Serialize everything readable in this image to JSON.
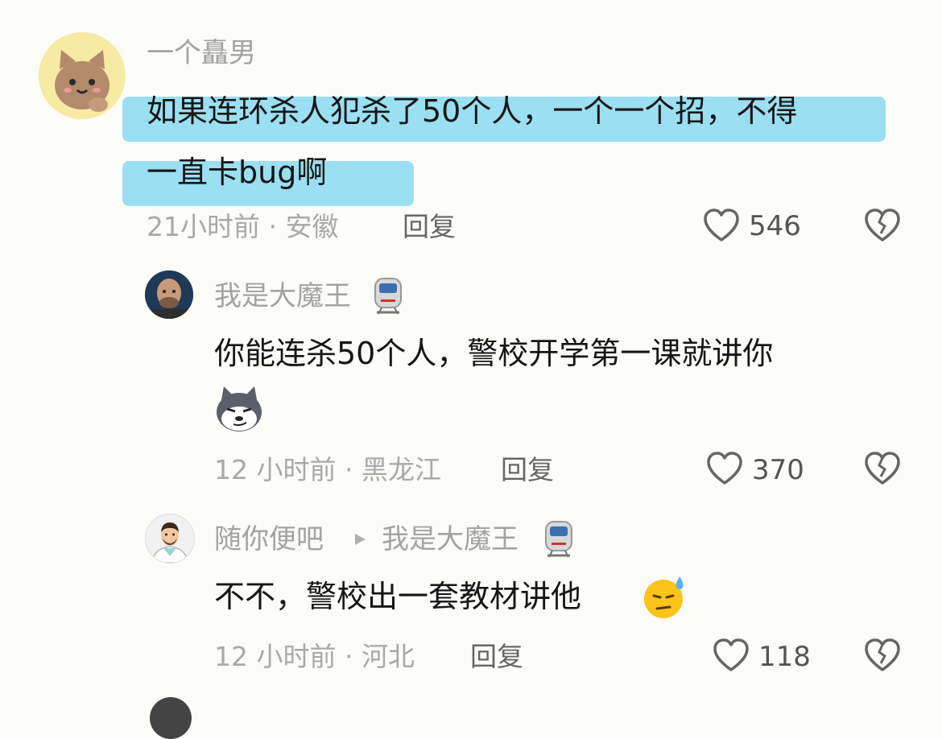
{
  "comments": [
    {
      "username": "一个矗男",
      "text_line1": "如果连环杀人犯杀了50个人，一个一个招，不得",
      "text_line2": "一直卡bug啊",
      "time_location": "21小时前 · 安徽",
      "reply_label": "回复",
      "likes": "546"
    },
    {
      "username": "我是大魔王",
      "text_line1": "你能连杀50个人，警校开学第一课就讲你",
      "time_location": "12 小时前 · 黑龙江",
      "reply_label": "回复",
      "likes": "370"
    },
    {
      "username": "随你便吧",
      "reply_to": "我是大魔王",
      "text_line1": "不不，警校出一套教材讲他",
      "time_location": "12 小时前 · 河北",
      "reply_label": "回复",
      "likes": "118"
    }
  ],
  "colors": {
    "highlight": "#8fdcf1",
    "background": "#fcfcf9"
  },
  "icons": [
    "cat-avatar",
    "person-avatar",
    "doctor-avatar",
    "train-emoji-icon",
    "dog-emoji-icon",
    "sweat-emoji-icon",
    "heart-icon",
    "broken-heart-icon",
    "reply-arrow-icon"
  ]
}
